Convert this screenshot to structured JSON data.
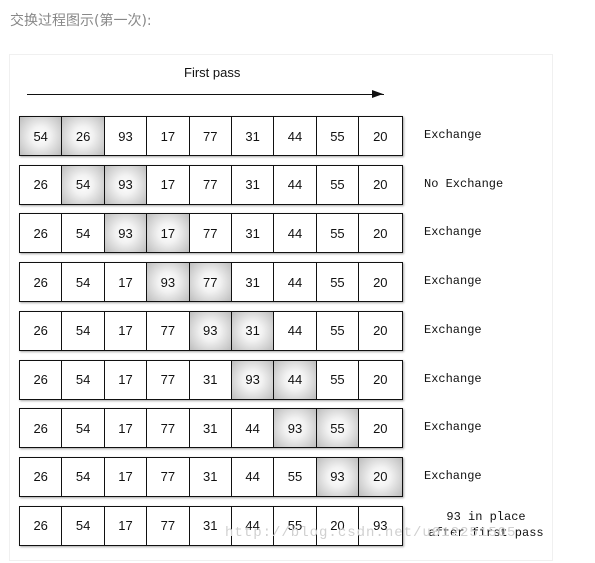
{
  "caption": "交换过程图示(第一次):",
  "pass_label": "First pass",
  "watermark": "http://blog.csdn.net/u012251505",
  "rows": [
    {
      "values": [
        "54",
        "26",
        "93",
        "17",
        "77",
        "31",
        "44",
        "55",
        "20"
      ],
      "highlight": [
        0,
        1
      ],
      "label": "Exchange"
    },
    {
      "values": [
        "26",
        "54",
        "93",
        "17",
        "77",
        "31",
        "44",
        "55",
        "20"
      ],
      "highlight": [
        1,
        2
      ],
      "label": "No Exchange"
    },
    {
      "values": [
        "26",
        "54",
        "93",
        "17",
        "77",
        "31",
        "44",
        "55",
        "20"
      ],
      "highlight": [
        2,
        3
      ],
      "label": "Exchange"
    },
    {
      "values": [
        "26",
        "54",
        "17",
        "93",
        "77",
        "31",
        "44",
        "55",
        "20"
      ],
      "highlight": [
        3,
        4
      ],
      "label": "Exchange"
    },
    {
      "values": [
        "26",
        "54",
        "17",
        "77",
        "93",
        "31",
        "44",
        "55",
        "20"
      ],
      "highlight": [
        4,
        5
      ],
      "label": "Exchange"
    },
    {
      "values": [
        "26",
        "54",
        "17",
        "77",
        "31",
        "93",
        "44",
        "55",
        "20"
      ],
      "highlight": [
        5,
        6
      ],
      "label": "Exchange"
    },
    {
      "values": [
        "26",
        "54",
        "17",
        "77",
        "31",
        "44",
        "93",
        "55",
        "20"
      ],
      "highlight": [
        6,
        7
      ],
      "label": "Exchange"
    },
    {
      "values": [
        "26",
        "54",
        "17",
        "77",
        "31",
        "44",
        "55",
        "93",
        "20"
      ],
      "highlight": [
        7,
        8
      ],
      "label": "Exchange"
    },
    {
      "values": [
        "26",
        "54",
        "17",
        "77",
        "31",
        "44",
        "55",
        "20",
        "93"
      ],
      "highlight": [],
      "label_lines": [
        "93 in place",
        "after first pass"
      ]
    }
  ]
}
